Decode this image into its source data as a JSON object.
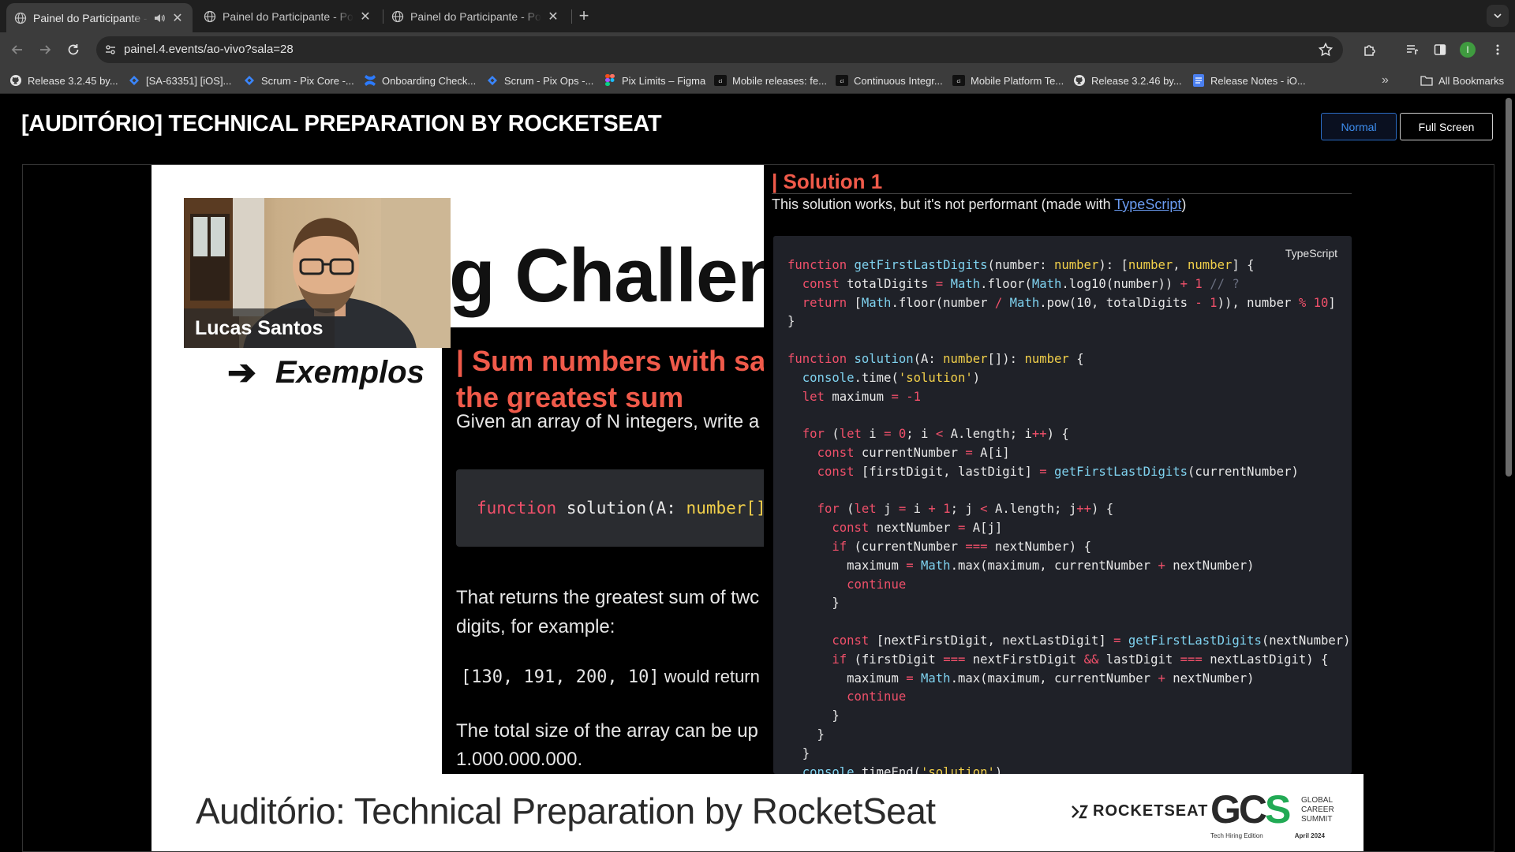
{
  "tabs": [
    {
      "title": "Painel do Participante - Powered by 4.events",
      "active": true,
      "audio": true
    },
    {
      "title": "Painel do Participante - Powered by 4.events",
      "active": false
    },
    {
      "title": "Painel do Participante - Powered by 4.events",
      "active": false
    }
  ],
  "toolbar": {
    "url": "painel.4.events/ao-vivo?sala=28",
    "profile_initial": "I"
  },
  "bookmarks": [
    {
      "label": "Release 3.2.45 by...",
      "icon": "github-icon"
    },
    {
      "label": "[SA-63351] [iOS]...",
      "icon": "jira-icon"
    },
    {
      "label": "Scrum - Pix Core -...",
      "icon": "jira-icon"
    },
    {
      "label": "Onboarding Check...",
      "icon": "confluence-icon"
    },
    {
      "label": "Scrum - Pix Ops -...",
      "icon": "jira-icon"
    },
    {
      "label": "Pix Limits – Figma",
      "icon": "figma-icon"
    },
    {
      "label": "Mobile releases: fe...",
      "icon": "app-icon"
    },
    {
      "label": "Continuous Integr...",
      "icon": "app-icon"
    },
    {
      "label": "Mobile Platform Te...",
      "icon": "app-icon"
    },
    {
      "label": "Release 3.2.46 by...",
      "icon": "github-icon"
    },
    {
      "label": "Release Notes - iO...",
      "icon": "docs-icon"
    }
  ],
  "all_bookmarks_label": "All Bookmarks",
  "page": {
    "title": "[AUDITÓRIO] TECHNICAL PREPARATION BY ROCKETSEAT",
    "normal_label": "Normal",
    "fullscreen_label": "Full Screen"
  },
  "video": {
    "speaker_name": "Lucas Santos",
    "challenge_text": "g Challen",
    "examples_label": "Exemplos",
    "sum_title_line1": "| Sum numbers with sa",
    "sum_title_line2": "the greatest sum",
    "given_text": "Given an array of N integers, write a",
    "snippet_kw": "function",
    "snippet_mid": "solution(A:",
    "snippet_type": "number[]",
    "returns_line1": "That returns the greatest sum of twc",
    "returns_line2": "digits, for example:",
    "example_code": "[130, 191, 200, 10]",
    "example_text": "would return",
    "total_line1": "The total size of the array can be up",
    "total_line2": "1.000.000.000.",
    "solution_title": "| Solution 1",
    "solution_sub_before": "This solution works, but it's not performant (made with ",
    "solution_sub_link": "TypeScript",
    "solution_sub_after": ")",
    "code_lang": "TypeScript",
    "lower_title": "Auditório: Technical Preparation by RocketSeat",
    "rocketseat_logo": "ROCKETSEAT",
    "gcs_letters_a": "GC",
    "gcs_letters_b": "S",
    "gcs_side_1": "GLOBAL",
    "gcs_side_2": "CAREER",
    "gcs_side_3": "SUMMIT",
    "gcs_foot_left": "Tech Hiring Edition",
    "gcs_foot_right": "April 2024"
  },
  "code_lines": [
    [
      [
        "c-kw",
        "function "
      ],
      [
        "c-fn",
        "getFirstLastDigits"
      ],
      [
        "",
        "(number: "
      ],
      [
        "c-ty",
        "number"
      ],
      [
        "",
        "): ["
      ],
      [
        "c-ty",
        "number"
      ],
      [
        "",
        ", "
      ],
      [
        "c-ty",
        "number"
      ],
      [
        "",
        "] {"
      ]
    ],
    [
      [
        "",
        "  "
      ],
      [
        "c-kw",
        "const "
      ],
      [
        "",
        "totalDigits "
      ],
      [
        "c-op",
        "= "
      ],
      [
        "c-fn",
        "Math"
      ],
      [
        "",
        ".floor("
      ],
      [
        "c-fn",
        "Math"
      ],
      [
        "",
        ".log10(number)) "
      ],
      [
        "c-op",
        "+ "
      ],
      [
        "c-num",
        "1 "
      ],
      [
        "c-cm",
        "// ?"
      ]
    ],
    [
      [
        "",
        "  "
      ],
      [
        "c-kw",
        "return "
      ],
      [
        "",
        "["
      ],
      [
        "c-fn",
        "Math"
      ],
      [
        "",
        ".floor(number "
      ],
      [
        "c-op",
        "/ "
      ],
      [
        "c-fn",
        "Math"
      ],
      [
        "",
        ".pow(10, totalDigits "
      ],
      [
        "c-op",
        "- "
      ],
      [
        "c-num",
        "1"
      ],
      [
        "",
        "))"
      ],
      [
        "",
        ", number "
      ],
      [
        "c-op",
        "% "
      ],
      [
        "c-num",
        "10"
      ],
      [
        "",
        "]"
      ]
    ],
    [
      [
        "",
        "}"
      ]
    ],
    [
      [
        "",
        ""
      ]
    ],
    [
      [
        "c-kw",
        "function "
      ],
      [
        "c-fn",
        "solution"
      ],
      [
        "",
        "(A: "
      ],
      [
        "c-ty",
        "number"
      ],
      [
        "",
        "[]): "
      ],
      [
        "c-ty",
        "number "
      ],
      [
        "",
        "{"
      ]
    ],
    [
      [
        "",
        "  "
      ],
      [
        "c-fn",
        "console"
      ],
      [
        "",
        ".time("
      ],
      [
        "c-str",
        "'solution'"
      ],
      [
        "",
        ")"
      ]
    ],
    [
      [
        "",
        "  "
      ],
      [
        "c-kw",
        "let "
      ],
      [
        "",
        "maximum "
      ],
      [
        "c-op",
        "= "
      ],
      [
        "c-num",
        "-1"
      ]
    ],
    [
      [
        "",
        ""
      ]
    ],
    [
      [
        "",
        "  "
      ],
      [
        "c-kw",
        "for "
      ],
      [
        "",
        "("
      ],
      [
        "c-kw",
        "let "
      ],
      [
        "",
        "i "
      ],
      [
        "c-op",
        "= "
      ],
      [
        "c-num",
        "0"
      ],
      [
        "",
        "; i "
      ],
      [
        "c-op",
        "< "
      ],
      [
        "",
        "A.length; i"
      ],
      [
        "c-op",
        "++"
      ],
      [
        "",
        ") {"
      ]
    ],
    [
      [
        "",
        "    "
      ],
      [
        "c-kw",
        "const "
      ],
      [
        "",
        "currentNumber "
      ],
      [
        "c-op",
        "= "
      ],
      [
        "",
        "A[i]"
      ]
    ],
    [
      [
        "",
        "    "
      ],
      [
        "c-kw",
        "const "
      ],
      [
        "",
        "[firstDigit, lastDigit] "
      ],
      [
        "c-op",
        "= "
      ],
      [
        "c-fn",
        "getFirstLastDigits"
      ],
      [
        "",
        "(currentNumber)"
      ]
    ],
    [
      [
        "",
        ""
      ]
    ],
    [
      [
        "",
        "    "
      ],
      [
        "c-kw",
        "for "
      ],
      [
        "",
        "("
      ],
      [
        "c-kw",
        "let "
      ],
      [
        "",
        "j "
      ],
      [
        "c-op",
        "= "
      ],
      [
        "",
        "i "
      ],
      [
        "c-op",
        "+ "
      ],
      [
        "c-num",
        "1"
      ],
      [
        "",
        "; j "
      ],
      [
        "c-op",
        "< "
      ],
      [
        "",
        "A.length; j"
      ],
      [
        "c-op",
        "++"
      ],
      [
        "",
        ") {"
      ]
    ],
    [
      [
        "",
        "      "
      ],
      [
        "c-kw",
        "const "
      ],
      [
        "",
        "nextNumber "
      ],
      [
        "c-op",
        "= "
      ],
      [
        "",
        "A[j]"
      ]
    ],
    [
      [
        "",
        "      "
      ],
      [
        "c-kw",
        "if "
      ],
      [
        "",
        "(currentNumber "
      ],
      [
        "c-op",
        "=== "
      ],
      [
        "",
        "nextNumber) {"
      ]
    ],
    [
      [
        "",
        "        "
      ],
      [
        "",
        "maximum "
      ],
      [
        "c-op",
        "= "
      ],
      [
        "c-fn",
        "Math"
      ],
      [
        "",
        ".max(maximum, currentNumber "
      ],
      [
        "c-op",
        "+ "
      ],
      [
        "",
        "nextNumber)"
      ]
    ],
    [
      [
        "",
        "        "
      ],
      [
        "c-kw",
        "continue"
      ]
    ],
    [
      [
        "",
        "      }"
      ]
    ],
    [
      [
        "",
        ""
      ]
    ],
    [
      [
        "",
        "      "
      ],
      [
        "c-kw",
        "const "
      ],
      [
        "",
        "[nextFirstDigit, nextLastDigit] "
      ],
      [
        "c-op",
        "= "
      ],
      [
        "c-fn",
        "getFirstLastDigits"
      ],
      [
        "",
        "(nextNumber)"
      ]
    ],
    [
      [
        "",
        "      "
      ],
      [
        "c-kw",
        "if "
      ],
      [
        "",
        "(firstDigit "
      ],
      [
        "c-op",
        "=== "
      ],
      [
        "",
        "nextFirstDigit "
      ],
      [
        "c-op",
        "&& "
      ],
      [
        "",
        "lastDigit "
      ],
      [
        "c-op",
        "=== "
      ],
      [
        "",
        "nextLastDigit) {"
      ]
    ],
    [
      [
        "",
        "        "
      ],
      [
        "",
        "maximum "
      ],
      [
        "c-op",
        "= "
      ],
      [
        "c-fn",
        "Math"
      ],
      [
        "",
        ".max(maximum, currentNumber "
      ],
      [
        "c-op",
        "+ "
      ],
      [
        "",
        "nextNumber)"
      ]
    ],
    [
      [
        "",
        "        "
      ],
      [
        "c-kw",
        "continue"
      ]
    ],
    [
      [
        "",
        "      }"
      ]
    ],
    [
      [
        "",
        "    }"
      ]
    ],
    [
      [
        "",
        "  }"
      ]
    ],
    [
      [
        "",
        "  "
      ],
      [
        "c-fn",
        "console"
      ],
      [
        "",
        ".timeEnd("
      ],
      [
        "c-str",
        "'solution'"
      ],
      [
        "",
        ")"
      ]
    ]
  ],
  "colors": {
    "accent_red": "#f05a4a",
    "link_blue": "#6b9cf2",
    "normal_button": "#3d8ef0"
  }
}
